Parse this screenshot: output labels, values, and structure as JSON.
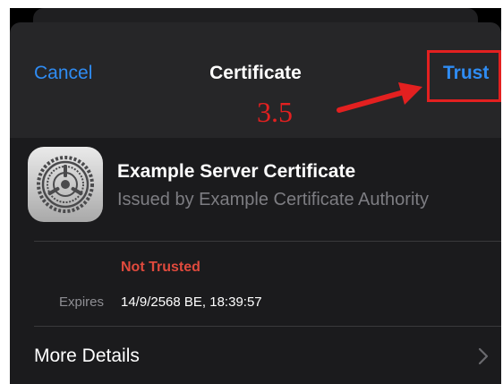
{
  "nav": {
    "cancel_label": "Cancel",
    "title": "Certificate",
    "trust_label": "Trust"
  },
  "annotation": {
    "step_label": "3.5",
    "color": "#e32020"
  },
  "certificate": {
    "icon": "settings-gear-icon",
    "name": "Example Server Certificate",
    "issuer": "Issued by Example Certificate Authority",
    "status": "Not Trusted",
    "status_color": "#e04a3d",
    "expires_label": "Expires",
    "expires_value": "14/9/2568 BE, 18:39:57"
  },
  "more_details": {
    "label": "More Details",
    "icon": "chevron-right-icon"
  },
  "colors": {
    "accent": "#2f8cf3",
    "background": "#1b1b1d",
    "nav_background": "#262628"
  }
}
